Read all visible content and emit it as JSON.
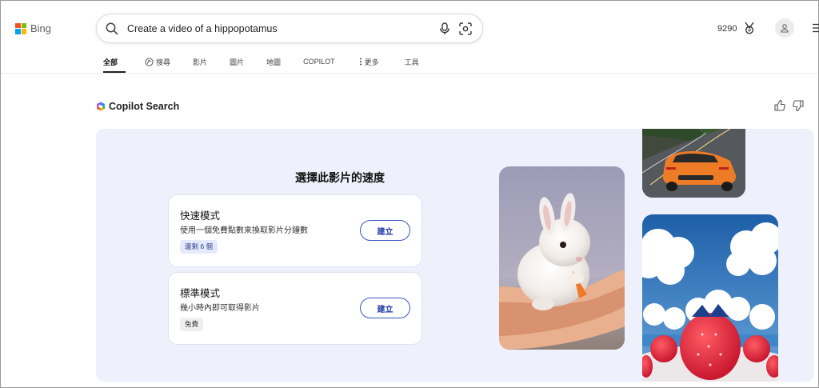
{
  "header": {
    "logo_text": "Bing",
    "search_value": "Create a video of a hippopotamus",
    "points": "9290"
  },
  "tabs": [
    {
      "label": "全部",
      "active": true
    },
    {
      "label": "搜尋",
      "icon": "copilot-search-icon"
    },
    {
      "label": "影片"
    },
    {
      "label": "圖片"
    },
    {
      "label": "地圖"
    },
    {
      "label": "COPILOT"
    },
    {
      "label": "更多",
      "icon": "more-vertical-icon"
    },
    {
      "label": "工具"
    }
  ],
  "copilot": {
    "title": "Copilot Search"
  },
  "panel": {
    "title": "選擇此影片的速度",
    "options": [
      {
        "name": "快速模式",
        "description": "使用一個免費點數來換取影片分鐘數",
        "badge": "還剩 6 個",
        "button": "建立"
      },
      {
        "name": "標準模式",
        "description": "幾小時內即可取得影片",
        "badge": "免費",
        "button": "建立"
      }
    ]
  },
  "thumbnails": [
    {
      "subject": "bunny-holding-carrot-image"
    },
    {
      "subject": "orange-sports-car-image"
    },
    {
      "subject": "strawberries-clouds-image"
    }
  ],
  "colors": {
    "accent": "#3c55c2",
    "panel_bg": "#eef0fb",
    "ms_red": "#f25022",
    "ms_green": "#7fba00",
    "ms_blue": "#00a4ef",
    "ms_yellow": "#ffb900"
  }
}
